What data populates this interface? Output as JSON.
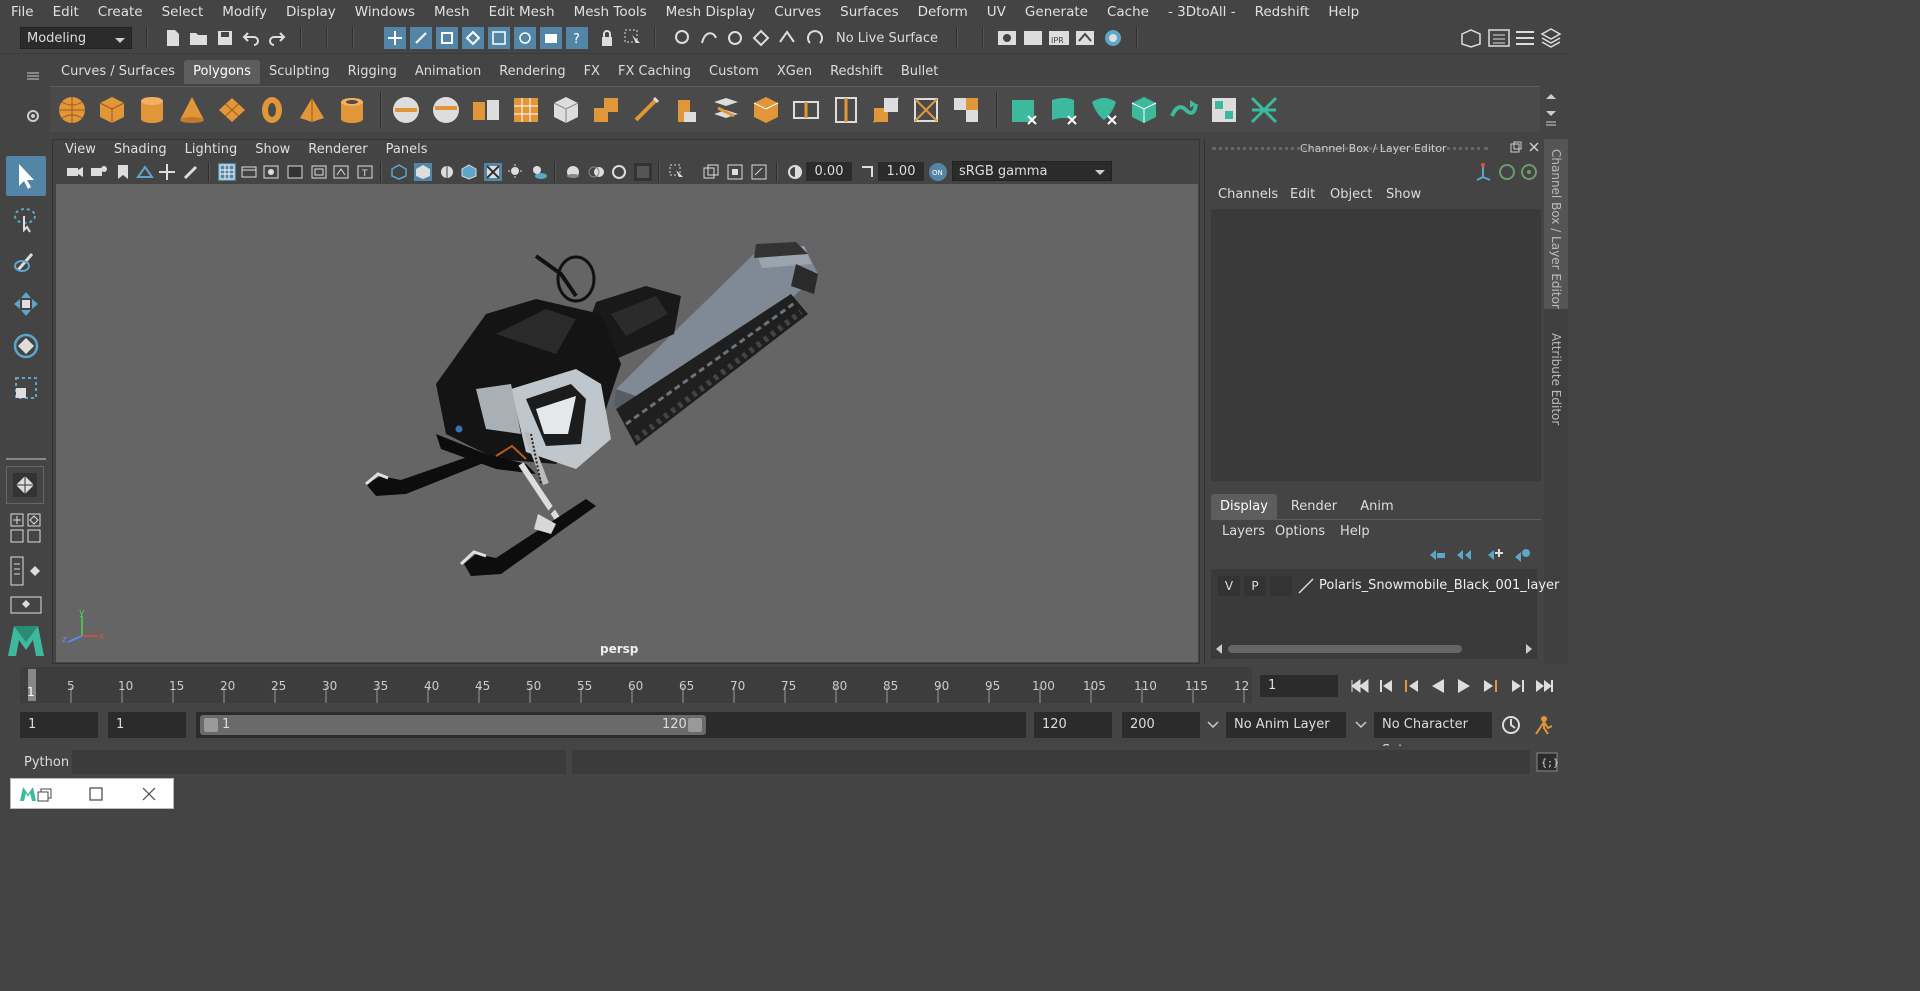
{
  "menubar": [
    "File",
    "Edit",
    "Create",
    "Select",
    "Modify",
    "Display",
    "Windows",
    "Mesh",
    "Edit Mesh",
    "Mesh Tools",
    "Mesh Display",
    "Curves",
    "Surfaces",
    "Deform",
    "UV",
    "Generate",
    "Cache",
    "- 3DtoAll -",
    "Redshift",
    "Help"
  ],
  "status": {
    "mode": "Modeling",
    "live_surface": "No Live Surface"
  },
  "shelf_tabs": [
    "Curves / Surfaces",
    "Polygons",
    "Sculpting",
    "Rigging",
    "Animation",
    "Rendering",
    "FX",
    "FX Caching",
    "Custom",
    "XGen",
    "Redshift",
    "Bullet"
  ],
  "active_shelf": "Polygons",
  "viewport": {
    "menus": [
      "View",
      "Shading",
      "Lighting",
      "Show",
      "Renderer",
      "Panels"
    ],
    "exposure": "0.00",
    "gamma": "1.00",
    "colorspace": "sRGB gamma",
    "camera": "persp"
  },
  "channel_box": {
    "title": "Channel Box / Layer Editor",
    "menus": [
      "Channels",
      "Edit",
      "Object",
      "Show"
    ],
    "side_tabs": [
      "Channel Box / Layer Editor",
      "Attribute Editor"
    ]
  },
  "layer_editor": {
    "tabs": [
      "Display",
      "Render",
      "Anim"
    ],
    "menus": [
      "Layers",
      "Options",
      "Help"
    ],
    "layer": {
      "v": "V",
      "p": "P",
      "name": "Polaris_Snowmobile_Black_001_layer"
    }
  },
  "timeline": {
    "ticks": [
      "1",
      "5",
      "10",
      "15",
      "20",
      "25",
      "30",
      "35",
      "40",
      "45",
      "50",
      "55",
      "60",
      "65",
      "70",
      "75",
      "80",
      "85",
      "90",
      "95",
      "100",
      "105",
      "110",
      "115",
      "12"
    ],
    "current_frame": "1"
  },
  "range": {
    "start": "1",
    "anim_start": "1",
    "slider_start": "1",
    "slider_end": "120",
    "end": "120",
    "anim_end": "200",
    "anim_layer": "No Anim Layer",
    "char_set": "No Character Set"
  },
  "cmd": {
    "lang": "Python"
  },
  "colors": {
    "accent": "#5285a6",
    "orange": "#e2963a",
    "teal": "#3dba9e"
  }
}
